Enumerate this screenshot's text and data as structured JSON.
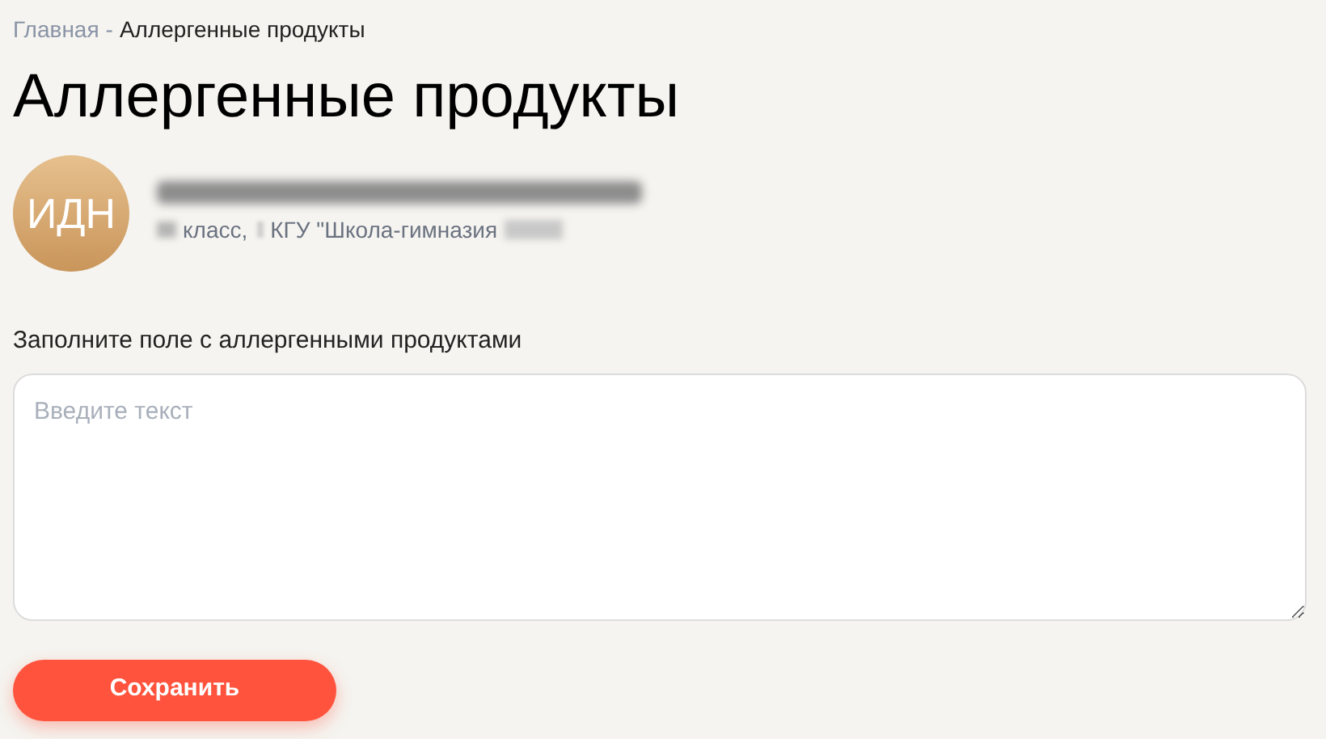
{
  "breadcrumb": [
    {
      "label": "Главная",
      "current": false,
      "separator": "-"
    },
    {
      "label": "Аллергенные продукты",
      "current": true
    }
  ],
  "title": "Аллергенные продукты",
  "profile": {
    "initials": "ИДН",
    "class_label": "класс,",
    "school": "КГУ \"Школа-гимназия"
  },
  "form": {
    "label": "Заполните поле с аллергенными продуктами",
    "placeholder": "Введите текст"
  },
  "buttons": [
    "Сохранить"
  ]
}
